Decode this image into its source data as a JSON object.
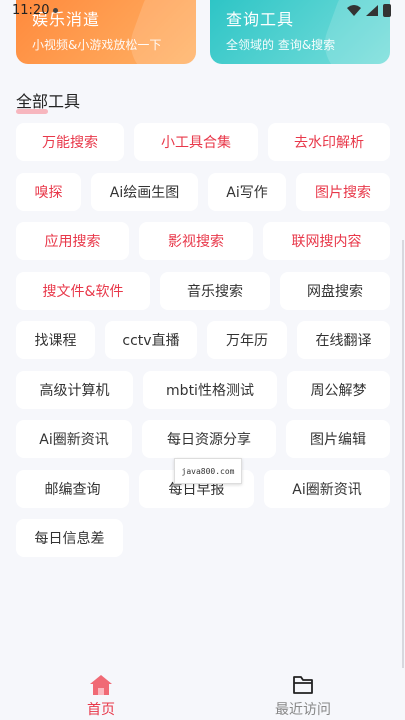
{
  "status_bar": {
    "time": "11:20"
  },
  "feature_cards": [
    {
      "title": "娱乐消遣",
      "subtitle": "小视频&小游戏放松一下"
    },
    {
      "title": "查询工具",
      "subtitle": "全领域的 查询&搜索"
    }
  ],
  "section": {
    "title": "全部工具"
  },
  "tools": [
    "万能搜索",
    "小工具合集",
    "去水印解析",
    "嗅探",
    "Ai绘画生图",
    "Ai写作",
    "图片搜索",
    "应用搜索",
    "影视搜索",
    "联网搜内容",
    "搜文件&软件",
    "音乐搜索",
    "网盘搜索",
    "找课程",
    "cctv直播",
    "万年历",
    "在线翻译",
    "高级计算机",
    "mbti性格测试",
    "周公解梦",
    "Ai圈新资讯",
    "每日资源分享",
    "图片编辑",
    "邮编查询",
    "每日早报",
    "Ai圈新资讯",
    "每日信息差"
  ],
  "watermark": "java800.com",
  "tabbar": {
    "home": "首页",
    "recent": "最近访问"
  },
  "colors": {
    "accent": "#e8384a",
    "orange": "#ff8a3d",
    "teal": "#2ec5c6"
  }
}
